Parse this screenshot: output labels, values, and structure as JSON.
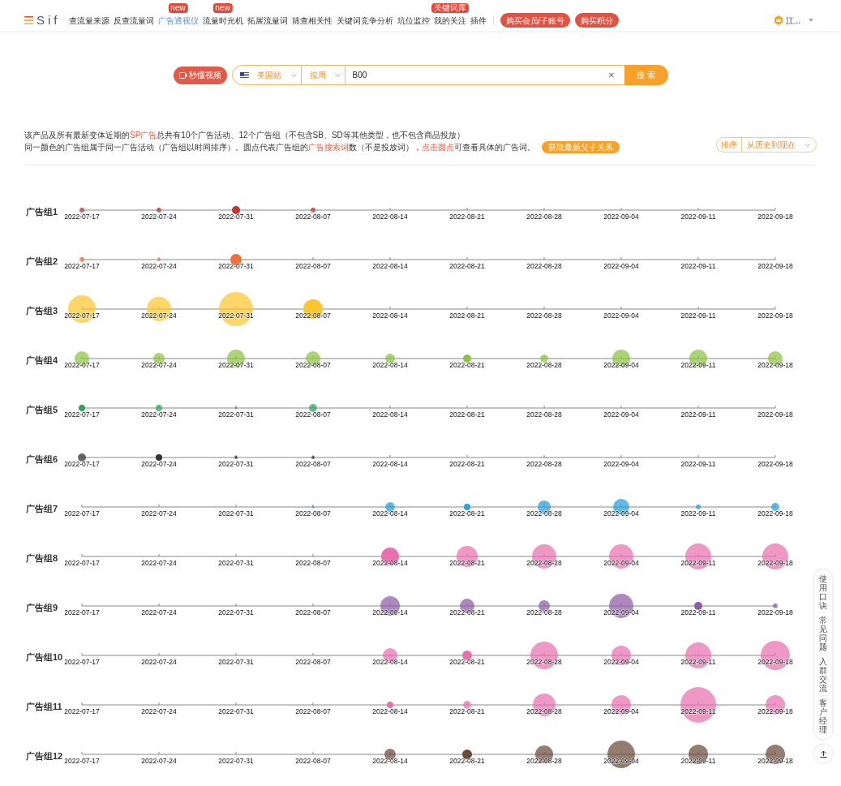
{
  "header": {
    "logo": "Sif",
    "nav": [
      {
        "label": "查流量来源",
        "selected": false
      },
      {
        "label": "反查流量词",
        "selected": false
      },
      {
        "label": "广告透视仪",
        "selected": true,
        "badge": "new"
      },
      {
        "label": "流量时光机",
        "selected": false,
        "badge": "new"
      },
      {
        "label": "拓展流量词",
        "selected": false
      },
      {
        "label": "筛查相关性",
        "selected": false
      },
      {
        "label": "关键词竞争分析",
        "selected": false
      },
      {
        "label": "坑位监控",
        "selected": false
      },
      {
        "label": "我的关注",
        "selected": false,
        "badge": "关键词库"
      },
      {
        "label": "插件",
        "selected": false
      }
    ],
    "buttons": [
      "购买会员/子账号",
      "购买积分"
    ],
    "user": "江..."
  },
  "search": {
    "video_button": "秒懂视频",
    "site": "美国站",
    "period": "按周",
    "value": "B00",
    "clear": "×",
    "submit": "搜 索"
  },
  "info": {
    "lines": [
      [
        {
          "text": "该产品及所有最新变体近期的"
        },
        {
          "text": "SP广告",
          "kind": "highlight"
        },
        {
          "text": "总共有10个广告活动、12个广告组（不包含SB、SD等其他类型，也不包含商品投放）"
        }
      ],
      [
        {
          "text": "同一颜色的广告组属于同一广告活动（广告组以时间排序）。圆点代表广告组的"
        },
        {
          "text": "广告搜索词",
          "kind": "highlight"
        },
        {
          "text": "数（不是投放词），"
        },
        {
          "text": "点击圆点",
          "kind": "highlight"
        },
        {
          "text": "可查看具体的广告词。"
        }
      ]
    ],
    "button": "获取最新父子关系",
    "sort_label": "排序",
    "sort_value": "从历史到现在"
  },
  "groups": [
    {
      "label": "广告组1",
      "color": "#c23531",
      "dates": [
        "2022-07-17",
        "2022-07-24",
        "2022-07-31",
        "2022-08-07",
        "2022-08-14",
        "2022-08-21",
        "2022-08-28",
        "2022-09-04",
        "2022-09-11",
        "2022-09-18"
      ]
    },
    {
      "label": "广告组2",
      "color": "#f0703c",
      "dates": [
        "2022-07-17",
        "2022-07-24",
        "2022-07-31",
        "2022-08-07",
        "2022-08-14",
        "2022-08-21",
        "2022-08-28",
        "2022-09-04",
        "2022-09-11",
        "2022-09-18"
      ]
    },
    {
      "label": "广告组3",
      "color": "#fdc52f",
      "dates": [
        "2022-07-17",
        "2022-07-24",
        "2022-07-31",
        "2022-08-07",
        "2022-08-14",
        "2022-08-21",
        "2022-08-28",
        "2022-09-04",
        "2022-09-11",
        "2022-09-18"
      ]
    },
    {
      "label": "广告组4",
      "color": "#8bc43f",
      "dates": [
        "2022-07-17",
        "2022-07-24",
        "2022-07-31",
        "2022-08-07",
        "2022-08-14",
        "2022-08-21",
        "2022-08-28",
        "2022-09-04",
        "2022-09-11",
        "2022-09-18"
      ]
    },
    {
      "label": "广告组5",
      "color": "#2ea35a",
      "dates": [
        "2022-07-17",
        "2022-07-24",
        "2022-07-31",
        "2022-08-07",
        "2022-08-14",
        "2022-08-21",
        "2022-08-28",
        "2022-09-04",
        "2022-09-11",
        "2022-09-18"
      ]
    },
    {
      "label": "广告组6",
      "color": "#333333",
      "dates": [
        "2022-07-17",
        "2022-07-24",
        "2022-07-31",
        "2022-08-07",
        "2022-08-14",
        "2022-08-21",
        "2022-08-28",
        "2022-09-04",
        "2022-09-11",
        "2022-09-18"
      ]
    },
    {
      "label": "广告组7",
      "color": "#26a0da",
      "dates": [
        "2022-07-17",
        "2022-07-24",
        "2022-07-31",
        "2022-08-07",
        "2022-08-14",
        "2022-08-21",
        "2022-08-28",
        "2022-09-04",
        "2022-09-11",
        "2022-09-18"
      ]
    },
    {
      "label": "广告组8",
      "color": "#e96fae",
      "dates": [
        "2022-07-17",
        "2022-07-24",
        "2022-07-31",
        "2022-08-07",
        "2022-08-14",
        "2022-08-21",
        "2022-08-28",
        "2022-09-04",
        "2022-09-11",
        "2022-09-18"
      ]
    },
    {
      "label": "广告组9",
      "color": "#8e5ba8",
      "dates": [
        "2022-07-17",
        "2022-07-24",
        "2022-07-31",
        "2022-08-07",
        "2022-08-14",
        "2022-08-21",
        "2022-08-28",
        "2022-09-04",
        "2022-09-11",
        "2022-09-18"
      ]
    },
    {
      "label": "广告组10",
      "color": "#e96fae",
      "dates": [
        "2022-07-17",
        "2022-07-24",
        "2022-07-31",
        "2022-08-07",
        "2022-08-14",
        "2022-08-21",
        "2022-08-28",
        "2022-09-04",
        "2022-09-11",
        "2022-09-18"
      ]
    },
    {
      "label": "广告组11",
      "color": "#e96fae",
      "dates": [
        "2022-07-17",
        "2022-07-24",
        "2022-07-31",
        "2022-08-07",
        "2022-08-14",
        "2022-08-21",
        "2022-08-28",
        "2022-09-04",
        "2022-09-11",
        "2022-09-18"
      ]
    },
    {
      "label": "广告组12",
      "color": "#6b4a3a",
      "dates": [
        "2022-07-17",
        "2022-07-24",
        "2022-07-31",
        "2022-08-07",
        "2022-08-14",
        "2022-08-21",
        "2022-08-28",
        "2022-09-04",
        "2022-09-11",
        "2022-09-18"
      ]
    }
  ],
  "side_panel": {
    "items": [
      "使用口诀",
      "常见问题",
      "入群交流",
      "客户经理"
    ]
  }
}
